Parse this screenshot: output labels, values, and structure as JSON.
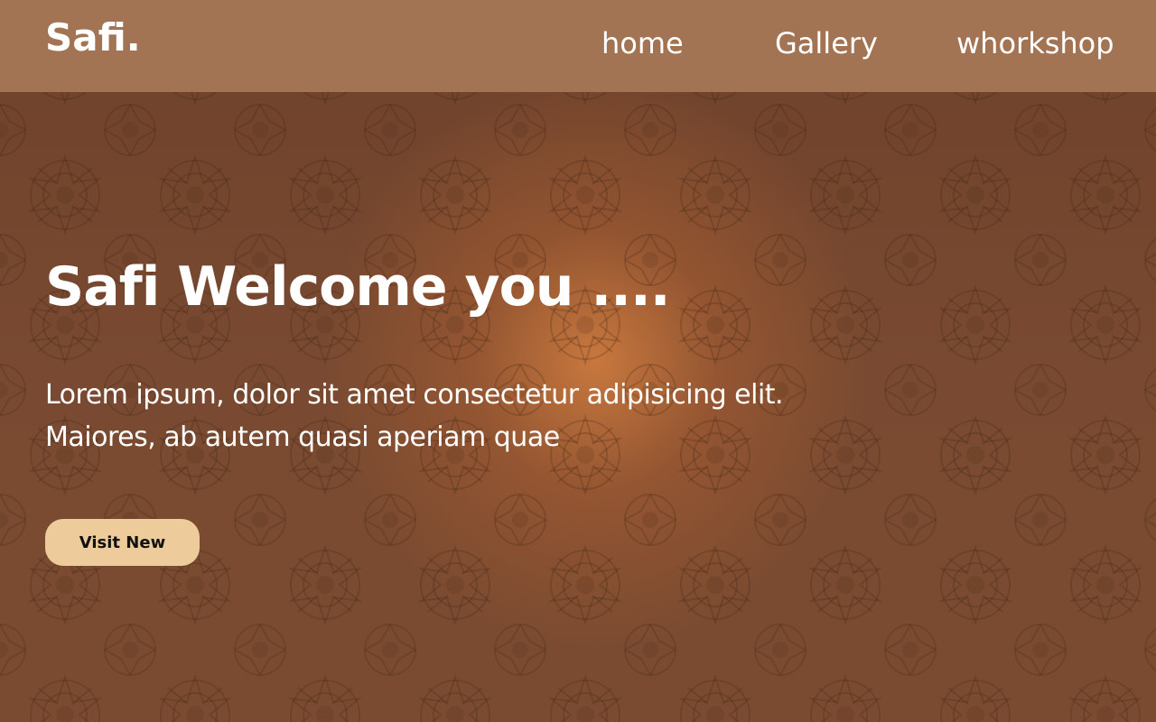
{
  "navbar": {
    "logo": "Safi.",
    "links": [
      {
        "label": "home"
      },
      {
        "label": "Gallery"
      },
      {
        "label": "whorkshop"
      }
    ]
  },
  "hero": {
    "title": "Safi Welcome you ....",
    "text_line1": "Lorem ipsum, dolor sit amet consectetur adipisicing elit.",
    "text_line2": "Maiores, ab autem quasi aperiam quae",
    "button_label": "Visit New"
  },
  "colors": {
    "navbar_bg": "#a27453",
    "hero_bg": "#7a4a30",
    "hero_glow": "#d68040",
    "button_bg": "#edcb9b",
    "text": "#ffffff"
  },
  "icons": {
    "background_pattern": "moroccan-star-pattern"
  }
}
